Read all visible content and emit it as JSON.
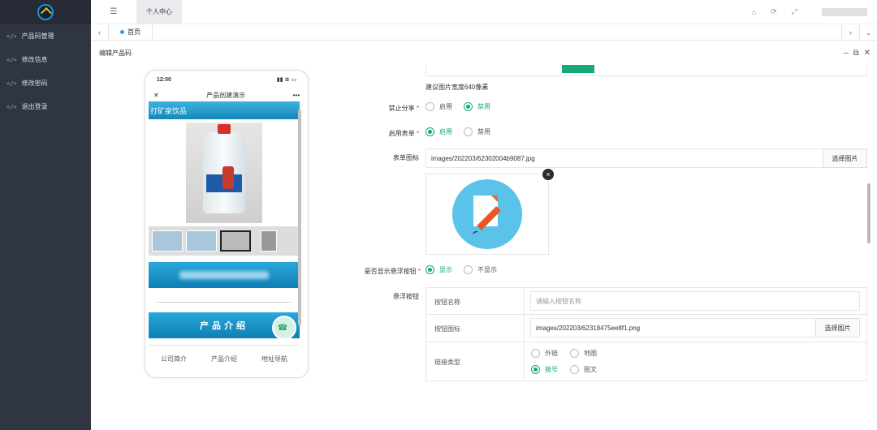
{
  "sidebar": {
    "items": [
      {
        "code": "</>",
        "label": "产品码管理"
      },
      {
        "code": "</>",
        "label": "修改信息"
      },
      {
        "code": "</>",
        "label": "修改密码"
      },
      {
        "code": "</>",
        "label": "退出登录"
      }
    ]
  },
  "topbar": {
    "tab_label": "个人中心",
    "icons": [
      "home-icon",
      "refresh-icon",
      "fullscreen-icon"
    ]
  },
  "tabbar": {
    "home_tab": "首页"
  },
  "window": {
    "title": "编辑产品码"
  },
  "phone": {
    "time": "12:00",
    "nav_title": "产品创建演示",
    "close": "✕",
    "more": "•••",
    "banner": "打矿泉饮品",
    "intro_button": "产品介绍",
    "footer": [
      "公司简介",
      "产品介绍",
      "地址导航"
    ]
  },
  "form": {
    "hint": "建议图片宽度640像素",
    "share_label": "禁止分享",
    "share_options": [
      "启用",
      "禁用"
    ],
    "share_selected": "禁用",
    "enable_form_label": "启用表单",
    "enable_form_options": [
      "启用",
      "禁用"
    ],
    "enable_form_selected": "启用",
    "form_icon_label": "表单图标",
    "form_icon_value": "images/202203/62302004b9087.jpg",
    "pick_image": "选择图片",
    "show_float_label": "是否显示悬浮按钮",
    "show_float_options": [
      "显示",
      "不显示"
    ],
    "show_float_selected": "显示",
    "float_button_label": "悬浮按钮",
    "float": {
      "name_label": "按钮名称",
      "name_placeholder": "请输入按钮名称",
      "icon_label": "按钮图标",
      "icon_value": "images/202203/62318475ee8f1.png",
      "pick_image": "选择图片",
      "link_type_label": "链接类型",
      "link_options": [
        "外链",
        "地图",
        "拨号",
        "图文"
      ],
      "link_selected": "拨号"
    },
    "required_mark": "*"
  },
  "colors": {
    "sidebar_bg": "#2f3541",
    "accent_green": "#16a77a",
    "banner_blue": "#1587b8"
  }
}
